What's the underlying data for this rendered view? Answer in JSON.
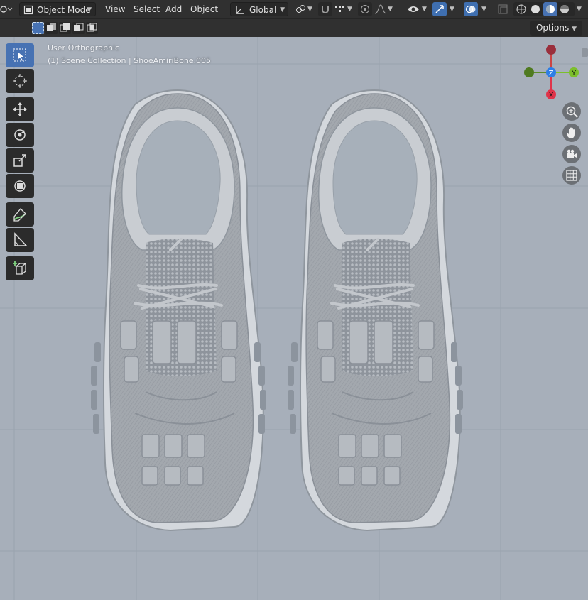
{
  "header": {
    "mode": "Object Mode",
    "menus": [
      "View",
      "Select",
      "Add",
      "Object"
    ],
    "transform_orientation": "Global"
  },
  "tool_settings": {
    "options_label": "Options"
  },
  "viewport": {
    "view_name": "User Orthographic",
    "collection_info": "(1) Scene Collection | ShoeAmiriBone.005",
    "background_color": "#a7afba"
  },
  "gizmo": {
    "z_label": "Z",
    "y_label": "Y",
    "x_label": "X",
    "colors": {
      "x": "#e0344a",
      "y": "#7cbf2c",
      "z": "#2d7ee6"
    }
  },
  "icons": {
    "toolbar": [
      "select-box-icon",
      "cursor-icon",
      "move-icon",
      "rotate-icon",
      "scale-icon",
      "transform-icon",
      "annotate-icon",
      "measure-icon",
      "add-cube-icon"
    ],
    "navigation": [
      "zoom-icon",
      "pan-hand-icon",
      "camera-icon",
      "grid-icon"
    ]
  }
}
